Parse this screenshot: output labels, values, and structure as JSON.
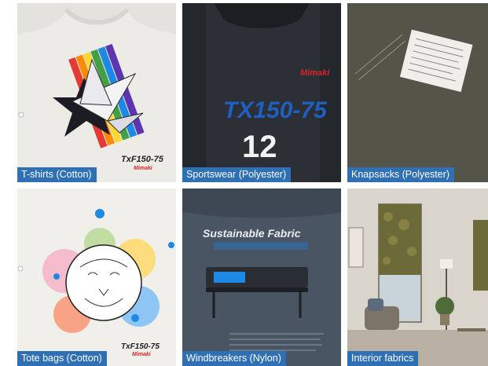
{
  "tiles": [
    {
      "caption": "T-shirts (Cotton)",
      "print_text": "TxF150-75",
      "brand": "Mimaki"
    },
    {
      "caption": "Sportswear (Polyester)",
      "print_text": "TX150-75",
      "brand": "Mimaki",
      "number": "12"
    },
    {
      "caption": "Knapsacks (Polyester)"
    },
    {
      "caption": "Tote bags (Cotton)",
      "print_text": "TxF150-75",
      "brand": "Mimaki"
    },
    {
      "caption": "Windbreakers (Nylon)",
      "headline": "Sustainable Fabric"
    },
    {
      "caption": "Interior fabrics"
    }
  ],
  "colors": {
    "caption_bg": "#2f6fb3",
    "caption_text": "#ffffff",
    "mimaki_red": "#d4262b"
  }
}
